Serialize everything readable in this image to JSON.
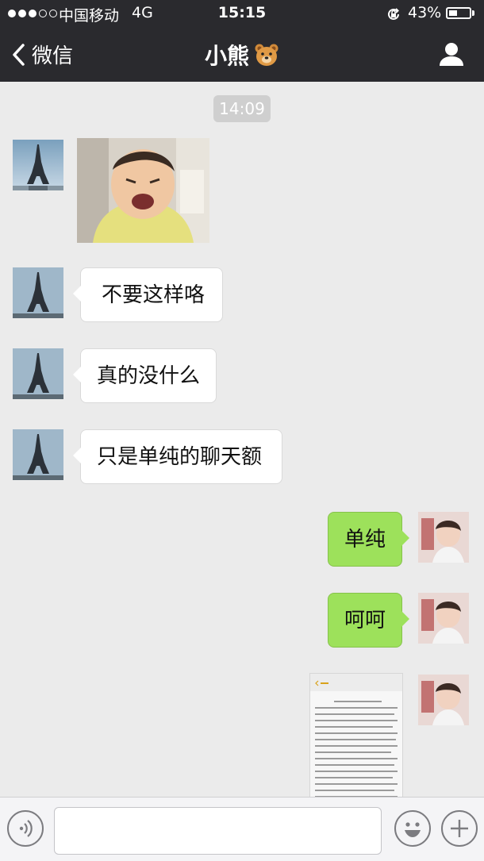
{
  "status_bar": {
    "carrier": "中国移动",
    "network": "4G",
    "time": "15:15",
    "battery_percent": "43%",
    "battery_level": 0.43
  },
  "nav": {
    "back_label": "微信",
    "title": "小熊",
    "title_emoji": "bear-face",
    "right_icon": "profile-icon"
  },
  "chat": {
    "timestamp": "14:09",
    "received": [
      {
        "type": "image",
        "description_icon": "crying-baby-photo"
      },
      {
        "type": "text",
        "text": "不要这样咯"
      },
      {
        "type": "text",
        "text": "真的没什么"
      },
      {
        "type": "text",
        "text": "只是单纯的聊天额"
      }
    ],
    "sent": [
      {
        "type": "text",
        "text": "单纯"
      },
      {
        "type": "text",
        "text": "呵呵"
      },
      {
        "type": "image",
        "description_icon": "chat-screenshot-thumbnail"
      }
    ]
  },
  "input_bar": {
    "voice_icon": "voice-icon",
    "emoji_icon": "emoji-icon",
    "plus_icon": "plus-icon",
    "placeholder": ""
  },
  "colors": {
    "header_bg": "#2a2a2e",
    "chat_bg": "#ebebeb",
    "sent_bubble": "#9de15b",
    "received_bubble": "#ffffff"
  }
}
